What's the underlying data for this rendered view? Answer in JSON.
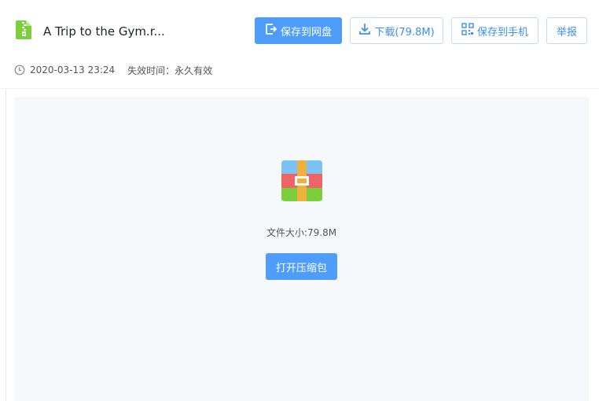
{
  "file": {
    "title": "A Trip to the Gym.r...",
    "date": "2020-03-13 23:24",
    "expire": "失效时间：永久有效",
    "size_text": "文件大小:79.8M",
    "icon": "zip-file-icon"
  },
  "toolbar": {
    "save_cloud_label": "保存到网盘",
    "download_label": "下载(79.8M)",
    "save_phone_label": "保存到手机",
    "report_label": "举报"
  },
  "preview": {
    "open_archive_label": "打开压缩包",
    "icon": "archive-icon"
  },
  "colors": {
    "primary": "#4e9dfa",
    "outline_border": "#bfdcfb",
    "outline_text": "#3c8ef3",
    "content_bg": "#f7f8fb",
    "file_icon_green": "#7ccf3c"
  }
}
